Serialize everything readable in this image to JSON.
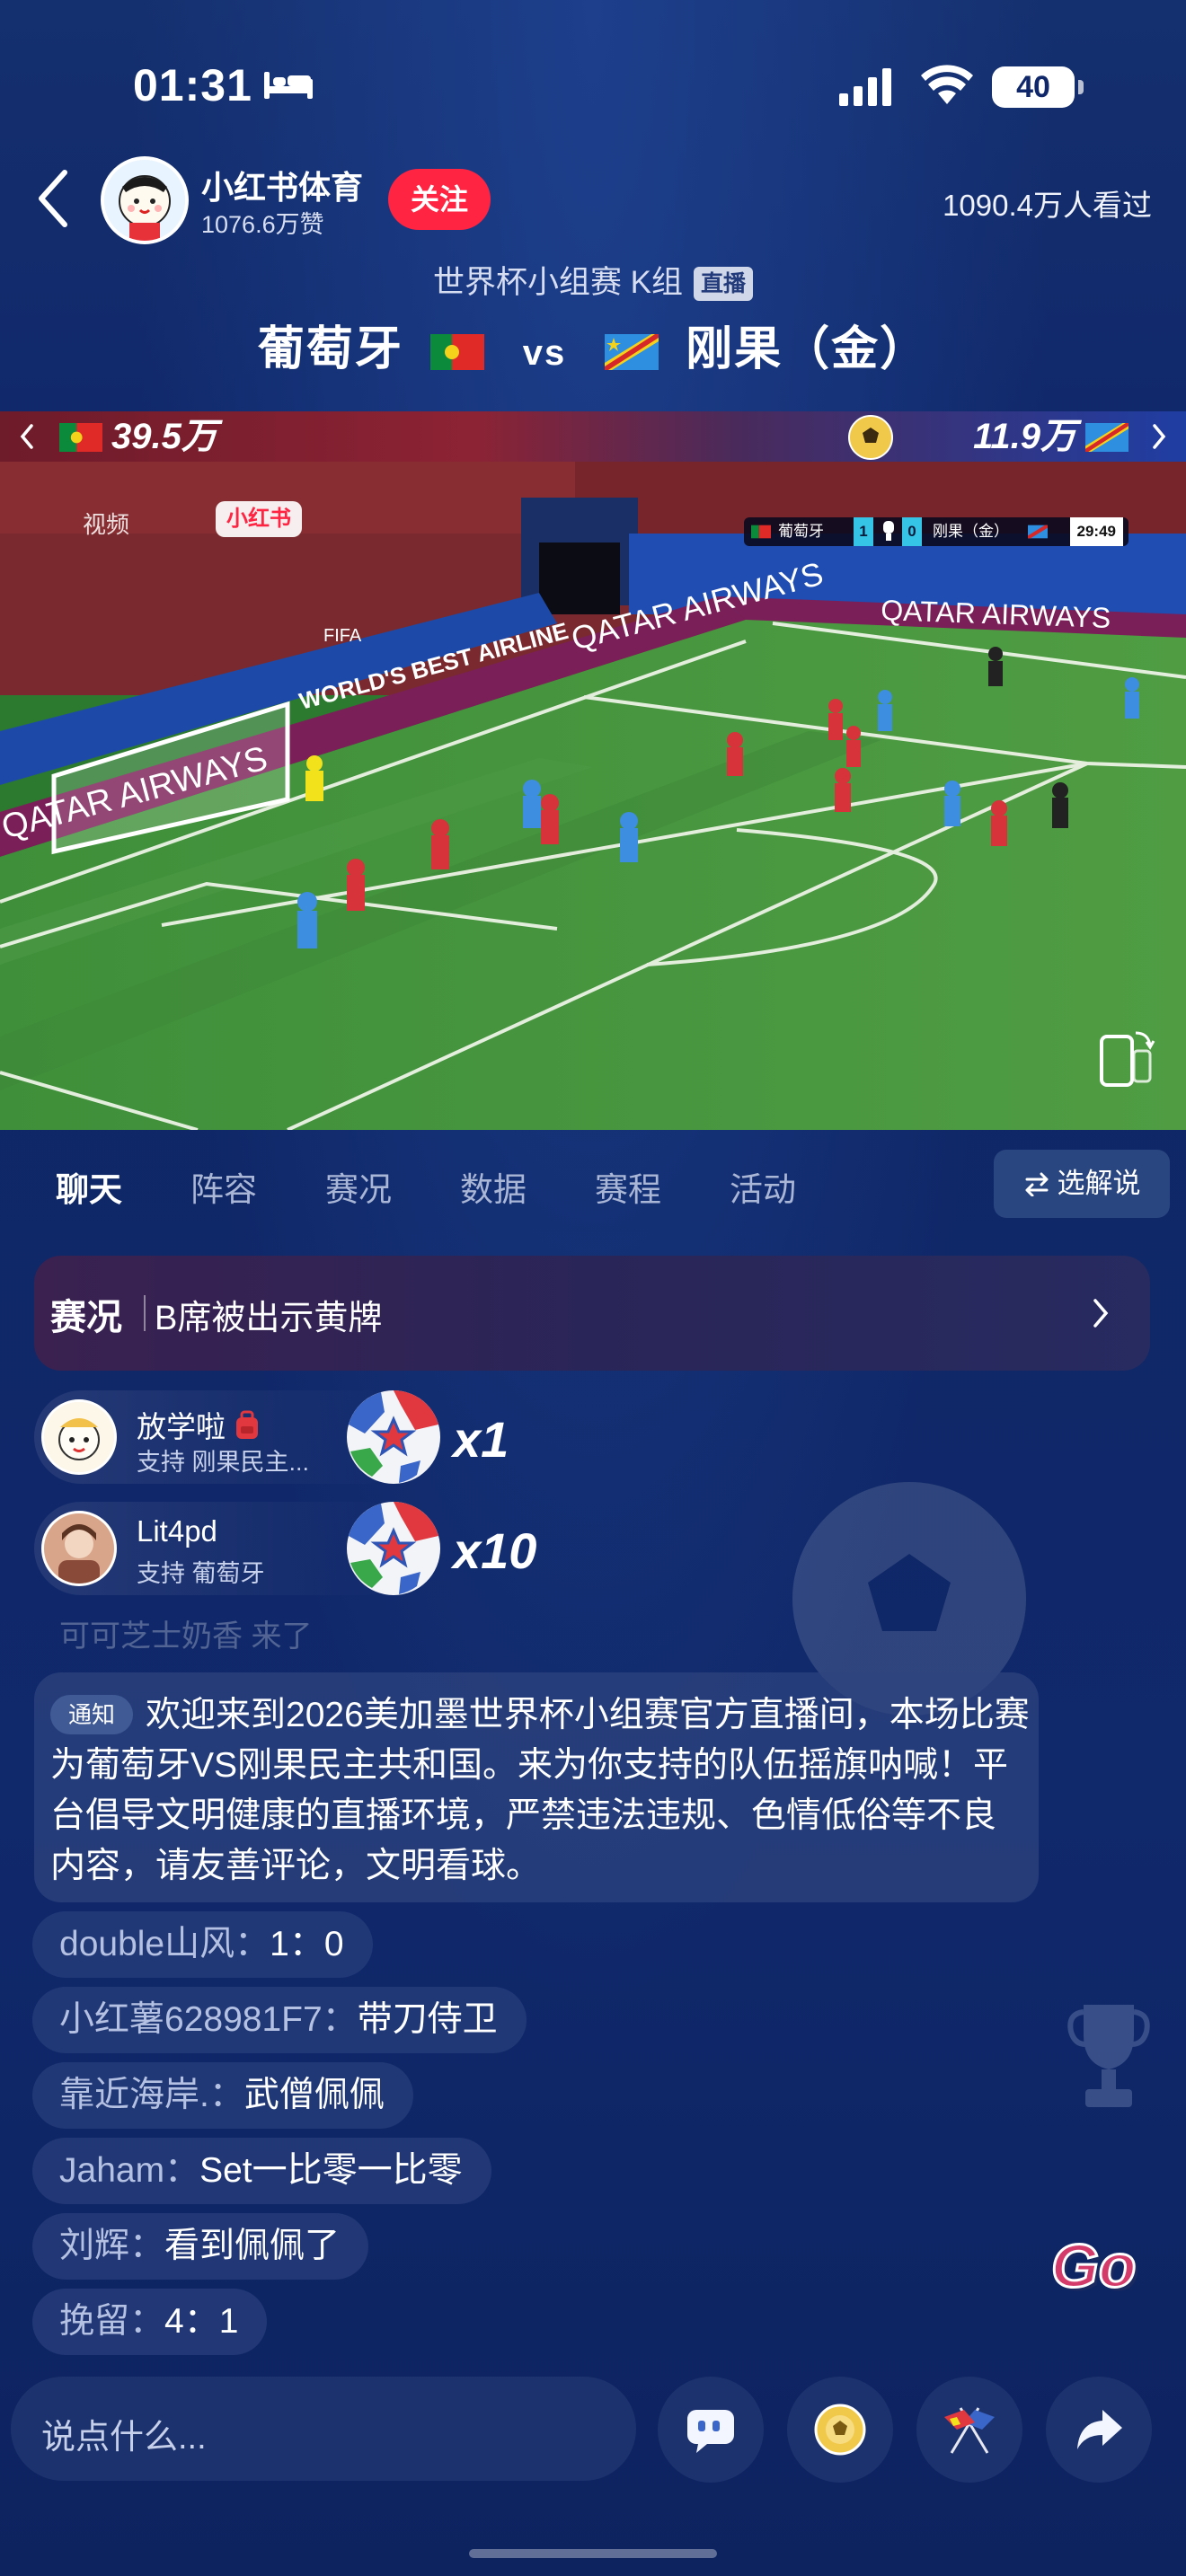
{
  "status_bar": {
    "time": "01:31",
    "battery": "40"
  },
  "header": {
    "channel_name": "小红书体育",
    "channel_likes": "1076.6万赞",
    "follow_label": "关注",
    "viewers": "1090.4万人看过",
    "match_stage": "世界杯小组赛 K组",
    "live_label": "直播",
    "home_team": "葡萄牙",
    "vs_label": "vs",
    "away_team": "刚果（金）"
  },
  "support_bar": {
    "home_support": "39.5万",
    "away_support": "11.9万"
  },
  "video": {
    "watermark": "小红书",
    "watermark_prefix": "视频",
    "scoreboard": {
      "home": "葡萄牙",
      "home_score": "1",
      "away_score": "0",
      "away": "刚果（金）",
      "clock": "29:49"
    },
    "ad_text": "QATAR AIRWAYS",
    "ad_text_2": "WORLD'S BEST AIRLINE",
    "board_text": "FIFA"
  },
  "tabs": {
    "items": [
      "聊天",
      "阵容",
      "赛况",
      "数据",
      "赛程",
      "活动"
    ],
    "active": "聊天",
    "commentary_label": "选解说"
  },
  "event_banner": {
    "tag": "赛况",
    "text": "B席被出示黄牌"
  },
  "gifts": [
    {
      "user": "放学啦",
      "support": "支持 刚果民主...",
      "count": "x1"
    },
    {
      "user": "Lit4pd",
      "support": "支持 葡萄牙",
      "count": "x10"
    }
  ],
  "faded_comment": "可可芝士奶香 来了",
  "notice": {
    "badge": "通知",
    "text": "欢迎来到2026美加墨世界杯小组赛官方直播间，本场比赛为葡萄牙VS刚果民主共和国。来为你支持的队伍摇旗呐喊！平台倡导文明健康的直播环境，严禁违法违规、色情低俗等不良内容，请友善评论，文明看球。"
  },
  "chat": [
    {
      "user": "double山风：",
      "text": "1：0"
    },
    {
      "user": "小红薯628981F7：",
      "text": "带刀侍卫"
    },
    {
      "user": "靠近海岸.：",
      "text": "武僧佩佩"
    },
    {
      "user": "Jaham：",
      "text": "Set一比零一比零"
    },
    {
      "user": "刘辉：",
      "text": "看到佩佩了"
    },
    {
      "user": "挽留：",
      "text": "4：1"
    }
  ],
  "sticker_text": "Go",
  "bottom_bar": {
    "input_placeholder": "说点什么..."
  },
  "colors": {
    "accent_red": "#ff2442",
    "background": "#10286a",
    "score_cyan": "#35c3e6"
  }
}
